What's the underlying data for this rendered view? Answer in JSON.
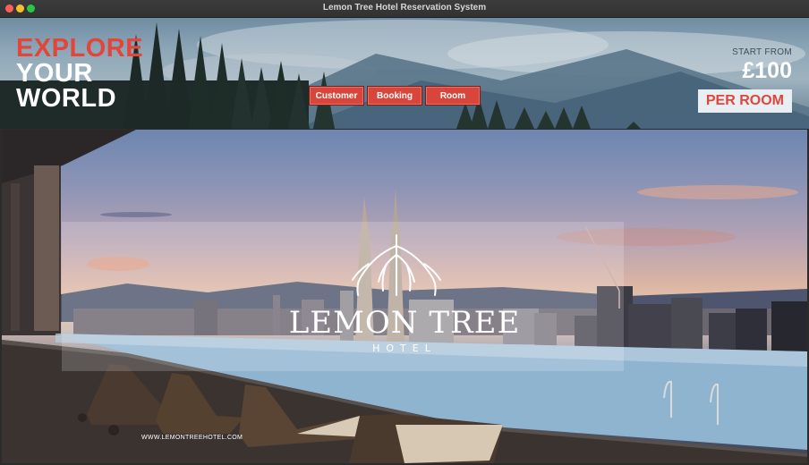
{
  "window": {
    "title": "Lemon Tree Hotel Reservation System"
  },
  "banner": {
    "headline": [
      "EXPLORE",
      "YOUR",
      "WORLD"
    ],
    "nav": [
      {
        "label": "Customer"
      },
      {
        "label": "Booking"
      },
      {
        "label": "Room"
      }
    ],
    "start_from": "START FROM",
    "price": "£100",
    "per_room": "PER ROOM"
  },
  "hero": {
    "brand": "LEMON TREE",
    "brand_sub": "HOTEL",
    "website": "WWW.LEMONTREEHOTEL.COM"
  },
  "colors": {
    "accent_red": "#e2463a",
    "button_red": "#d8463b",
    "title_bar": "#363636"
  }
}
